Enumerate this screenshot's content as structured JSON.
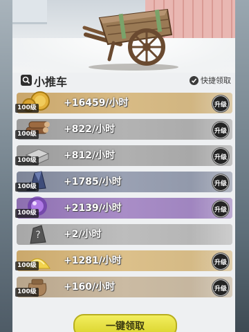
{
  "header": {
    "title": "小推车",
    "quick_claim_label": "快捷领取"
  },
  "resources": [
    {
      "icon": "gold-coin-icon",
      "level": "100级",
      "rate": "+16459/小时",
      "upgrade": "升级",
      "theme": "gold"
    },
    {
      "icon": "wood-logs-icon",
      "level": "100级",
      "rate": "+822/小时",
      "upgrade": "升级",
      "theme": "wood"
    },
    {
      "icon": "stone-block-icon",
      "level": "100级",
      "rate": "+812/小时",
      "upgrade": "升级",
      "theme": "stone"
    },
    {
      "icon": "iron-ore-icon",
      "level": "100级",
      "rate": "+1785/小时",
      "upgrade": "升级",
      "theme": "iron"
    },
    {
      "icon": "crystal-orb-icon",
      "level": "100级",
      "rate": "+2139/小时",
      "upgrade": "升级",
      "theme": "crystal"
    },
    {
      "icon": "unknown-resource-icon",
      "level": "",
      "rate": "+2/小时",
      "upgrade": "",
      "theme": "unknown"
    },
    {
      "icon": "sand-pile-icon",
      "level": "100级",
      "rate": "+1281/小时",
      "upgrade": "升级",
      "theme": "sand"
    },
    {
      "icon": "sack-icon",
      "level": "100级",
      "rate": "+160/小时",
      "upgrade": "升级",
      "theme": "bag"
    }
  ],
  "footer": {
    "claim_all_label": "一键领取"
  },
  "colors": {
    "claim_button": "#e6df3a",
    "upgrade_button": "#242424"
  }
}
